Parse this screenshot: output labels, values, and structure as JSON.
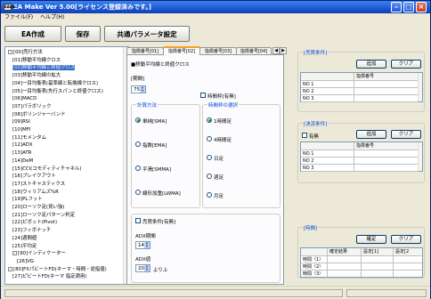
{
  "window": {
    "title": "EA Make Ver 5.00[ライセンス登録済みです。]",
    "logo": "EAmk"
  },
  "menu": [
    "ファイル(F)",
    "ヘルプ(H)"
  ],
  "toolbar": {
    "create": "EA作成",
    "save": "保存",
    "common_params": "共通パラメータ設定"
  },
  "tree": [
    {
      "text": "[00]売行方法",
      "depth": 0,
      "expander": "⊟"
    },
    {
      "text": "[01]移動平均線クロス",
      "depth": 1
    },
    {
      "text": "[02]移動平均線と終値クロス",
      "depth": 1,
      "selected": true
    },
    {
      "text": "[03]移動平均線の拡大",
      "depth": 1
    },
    {
      "text": "[04]一目均衡表(基準線と転換線クロス)",
      "depth": 1
    },
    {
      "text": "[05]一目均衡表(先行スパンと終値クロス)",
      "depth": 1
    },
    {
      "text": "[06]MACD",
      "depth": 1
    },
    {
      "text": "[07]パラボリック",
      "depth": 1
    },
    {
      "text": "[08]ボリンジャーバンド",
      "depth": 1
    },
    {
      "text": "[09]RSI",
      "depth": 1
    },
    {
      "text": "[10]MFI",
      "depth": 1
    },
    {
      "text": "[11]モメンタム",
      "depth": 1
    },
    {
      "text": "[12]ADX",
      "depth": 1
    },
    {
      "text": "[13]ATR",
      "depth": 1
    },
    {
      "text": "[14]DeM",
      "depth": 1
    },
    {
      "text": "[15]CCI(コモディティチャネル)",
      "depth": 1
    },
    {
      "text": "[16]ブレイクアウト",
      "depth": 1
    },
    {
      "text": "[17]ストキャスティクス",
      "depth": 1
    },
    {
      "text": "[18]ウィリアムズ%R",
      "depth": 1
    },
    {
      "text": "[19]PLフット",
      "depth": 1
    },
    {
      "text": "[20]ローソク足(買い強)",
      "depth": 1
    },
    {
      "text": "[21]ローソク足パターン判定",
      "depth": 1
    },
    {
      "text": "[22]ピボット(Pivot)",
      "depth": 1
    },
    {
      "text": "[23]フィボナッチ",
      "depth": 1
    },
    {
      "text": "[24]週間値",
      "depth": 1
    },
    {
      "text": "[25]平均足",
      "depth": 1
    },
    {
      "text": "[90]インディケーター",
      "depth": 1,
      "expander": "⊟"
    },
    {
      "text": "[26]VG",
      "depth": 2
    },
    {
      "text": "[80]FXパビートFD(ネーマ・時間・逆指値)",
      "depth": 0,
      "expander": "⊟"
    },
    {
      "text": "[27]ピビートFD(ネーマ 指定適用)",
      "depth": 1
    }
  ],
  "tabs": {
    "items": [
      "指標番号[01]",
      "指標番号[02]",
      "指標番号[03]",
      "指標番号[04]"
    ],
    "active_index": 1,
    "nav_prev": "◀",
    "nav_next": "▶"
  },
  "panel": {
    "heading": "■移動平均線と終値クロス",
    "period_label": "[期間]",
    "period_value": "75",
    "time_frame_check_label": "時間枠[有無]",
    "calc_group_title": "計算方法",
    "calc_options": [
      "単純[SMA]",
      "指数[EMA]",
      "平滑[SMMA]",
      "線形加重[LWMA]"
    ],
    "calc_selected": 0,
    "tf_group_title": "時間枠の選択",
    "tf_options": [
      "1時間足",
      "4時間足",
      "日足",
      "週足",
      "月足"
    ],
    "tf_selected": 0,
    "sell_cond_label": "売買条件[有無]",
    "adx_period_label": "ADX期間",
    "adx_period_value": "14",
    "adx_value_label": "ADX値",
    "adx_value_value": "20",
    "adx_suffix": "より上"
  },
  "right": {
    "buy": {
      "title": "[売買条件]",
      "add": "追加",
      "clear": "クリア",
      "header": "指標番号",
      "rows": [
        "NO 1",
        "NO 2",
        "NO 3"
      ]
    },
    "settle": {
      "title": "[決済条件]",
      "checkbox": "有無",
      "add": "追加",
      "clear": "クリア",
      "header": "指標番号",
      "rows": [
        "NO 1",
        "NO 2",
        "NO 3"
      ]
    },
    "time": {
      "title": "[時間]",
      "confirm": "確定",
      "clear": "クリア",
      "headers": [
        "確定結果",
        "設定[1]",
        "設定[2"
      ],
      "rows": [
        "時間〈1〉",
        "時間〈2〉",
        "時間〈3〉"
      ]
    }
  }
}
